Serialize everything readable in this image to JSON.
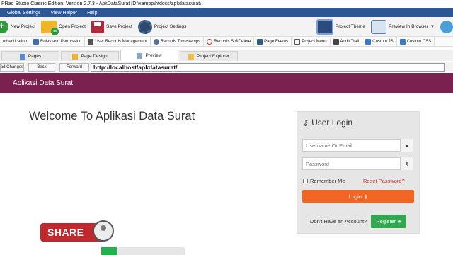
{
  "window": {
    "title": "PRad Studio Classic Edition.  Version 2.7.3 - ApkDataSurat [D:\\xampp\\htdocs\\apkdatasurat\\]"
  },
  "menu": {
    "items": [
      "Global Settings",
      "View Helper",
      "Help"
    ]
  },
  "ribbon": {
    "new_project": "New Project",
    "open_project": "Open Project",
    "save_project": "Save Project",
    "project_settings": "Project Settings",
    "project_theme": "Project Theme",
    "preview_in_browser": "Preview In Browser"
  },
  "toolbar": {
    "items": [
      "uthentication",
      "Roles and Permission",
      "User Records Management",
      "Records Timestamps",
      "Records SoftDelete",
      "Page Events",
      "Project Menu",
      "Audit Trail",
      "Custom JS",
      "Custom CSS"
    ]
  },
  "tabs": {
    "items": [
      "Pages",
      "Page Design",
      "Preview",
      "Project Explorer"
    ]
  },
  "address": {
    "load_changes": "ad Changes",
    "back": "Back",
    "forward": "Forward",
    "url": "http://localhost/apkdatasurat/"
  },
  "app": {
    "header_title": "Aplikasi Data Surat",
    "welcome": "Welcome To Aplikasi Data Surat"
  },
  "login": {
    "title": "User Login",
    "username_placeholder": "Username Or Email",
    "password_placeholder": "Password",
    "remember_label": "Remember Me",
    "reset_link": "Reset Password?",
    "login_button": "Login",
    "no_account_text": "Don't Have an Account?",
    "register_button": "Register"
  },
  "overlay": {
    "share_label": "SHARE"
  },
  "colors": {
    "menu_bg": "#2b5797",
    "app_header": "#7b2150",
    "login_button": "#f26522",
    "register_button": "#2fa84f",
    "share_bg": "#c0282d"
  }
}
